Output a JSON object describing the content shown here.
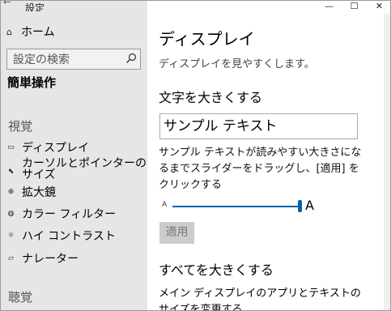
{
  "window": {
    "title": "設定"
  },
  "controls": {
    "minimize": "—",
    "maximize": "☐",
    "close": "✕"
  },
  "sidebar": {
    "home_label": "ホーム",
    "search_placeholder": "設定の検索",
    "category": "簡単操作",
    "group_vision": "視覚",
    "items": [
      {
        "label": "ディスプレイ",
        "icon": "monitor-icon"
      },
      {
        "label": "カーソルとポインターのサイズ",
        "icon": "cursor-icon"
      },
      {
        "label": "拡大鏡",
        "icon": "magnifier-icon"
      },
      {
        "label": "カラー フィルター",
        "icon": "color-filter-icon"
      },
      {
        "label": "ハイ コントラスト",
        "icon": "brightness-icon"
      },
      {
        "label": "ナレーター",
        "icon": "narrator-icon"
      }
    ],
    "group_hearing": "聴覚"
  },
  "main": {
    "title": "ディスプレイ",
    "subtitle": "ディスプレイを見やすくします。",
    "section_text_size": "文字を大きくする",
    "sample_text": "サンプル テキスト",
    "description": "サンプル テキストが読みやすい大きさになるまでスライダーをドラッグし、[適用] をクリックする",
    "slider_small_label": "A",
    "slider_large_label": "A",
    "slider_value": 1.0,
    "apply_label": "適用",
    "section_everything": "すべてを大きくする",
    "description2": "メイン ディスプレイのアプリとテキストのサイズを変更する"
  },
  "colors": {
    "accent": "#0063b1",
    "sidebar_bg": "#e6e6e6"
  }
}
